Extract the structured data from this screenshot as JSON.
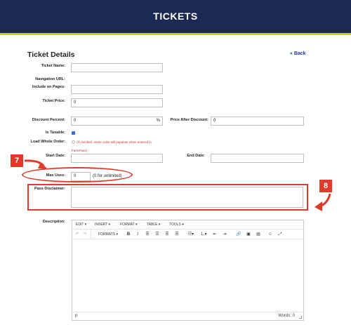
{
  "header": {
    "title": "TICKETS"
  },
  "section": {
    "title": "Ticket Details",
    "back": "« Back"
  },
  "form": {
    "ticket_name": {
      "label": "Ticket Name:",
      "value": ""
    },
    "nav_url": {
      "label": "Navigation URL:"
    },
    "include_pages": {
      "label": "Include on Pages:",
      "value": ""
    },
    "ticket_price": {
      "label": "Ticket Price:",
      "value": "0"
    },
    "discount_percent": {
      "label": "Discount Percent:",
      "value": "0",
      "unit": "%"
    },
    "price_after_discount": {
      "label": "Price After Discount:",
      "value": "0"
    },
    "is_taxable": {
      "label": "Is Taxable:",
      "checked": true
    },
    "load_whole_order": {
      "label": "Load Whole Order:",
      "note_line1": "(If checked, entire order will populate when entered in",
      "note_line2": "FarmPass)"
    },
    "start_date": {
      "label": "Start Date:",
      "value": ""
    },
    "end_date": {
      "label": "End Date:",
      "value": ""
    },
    "max_uses": {
      "label": "Max Uses:",
      "value": "0",
      "hint": "(0 for unlimited)"
    },
    "pass_disclaimer": {
      "label": "Pass Disclaimer:",
      "value": ""
    },
    "description": {
      "label": "Description:"
    }
  },
  "annotations": {
    "badge_7": "7",
    "badge_8": "8"
  },
  "editor": {
    "menus": [
      "EDIT ▾",
      "INSERT ▾",
      "FORMAT ▾",
      "TABLE ▾",
      "TOOLS ▾"
    ],
    "formats_label": "FORMATS ▾",
    "status_path": "p",
    "word_count": "Words: 0"
  },
  "colors": {
    "header_bg": "#1c2951",
    "header_accent": "#c8d400",
    "annotation": "#e03a2a",
    "link": "#1a3a8a"
  }
}
